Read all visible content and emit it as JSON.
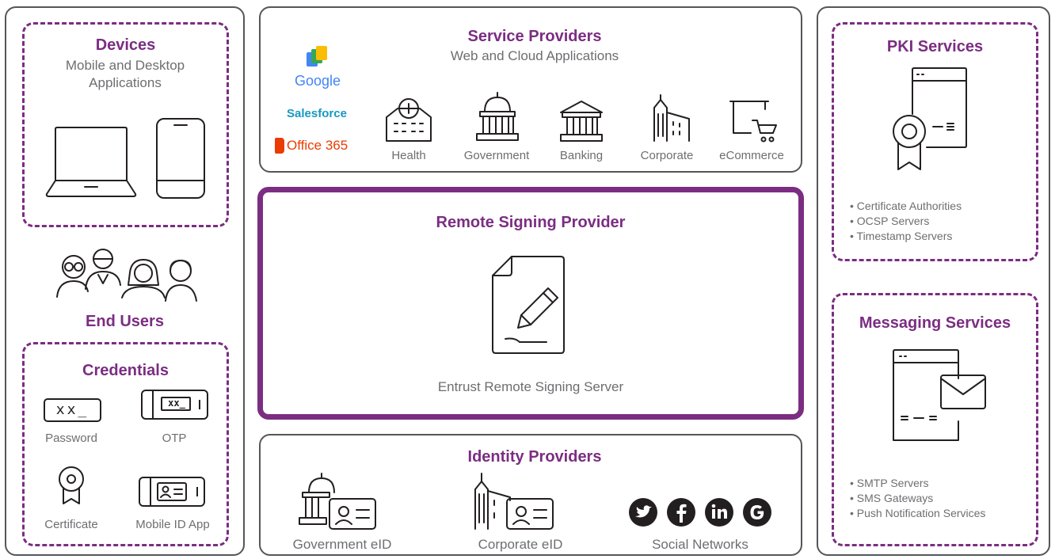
{
  "colors": {
    "accent": "#7b2d82",
    "border": "#55565a",
    "text": "#6d6e71",
    "icon": "#231f20"
  },
  "left": {
    "devices": {
      "title": "Devices",
      "subtitle": "Mobile and Desktop Applications"
    },
    "end_users": {
      "title": "End Users"
    },
    "credentials": {
      "title": "Credentials",
      "password_label": "Password",
      "password_glyph": "xx_",
      "otp_label": "OTP",
      "otp_glyph": "xx_",
      "certificate_label": "Certificate",
      "mobile_id_label": "Mobile ID App"
    }
  },
  "service_providers": {
    "title": "Service Providers",
    "subtitle": "Web and Cloud Applications",
    "brands": {
      "google": "Google",
      "salesforce": "Salesforce",
      "office365": "Office 365"
    },
    "sectors": [
      "Health",
      "Government",
      "Banking",
      "Corporate",
      "eCommerce"
    ]
  },
  "remote_signing": {
    "title": "Remote Signing Provider",
    "server_label": "Entrust Remote Signing Server"
  },
  "identity_providers": {
    "title": "Identity Providers",
    "items": [
      "Government eID",
      "Corporate eID",
      "Social Networks"
    ],
    "social_icons": [
      "twitter-icon",
      "facebook-icon",
      "linkedin-icon",
      "google-icon"
    ]
  },
  "pki": {
    "title": "PKI Services",
    "bullets": [
      "• Certificate Authorities",
      "• OCSP Servers",
      "• Timestamp Servers"
    ]
  },
  "messaging": {
    "title": "Messaging Services",
    "bullets": [
      "• SMTP Servers",
      "• SMS Gateways",
      "• Push Notification Services"
    ]
  }
}
